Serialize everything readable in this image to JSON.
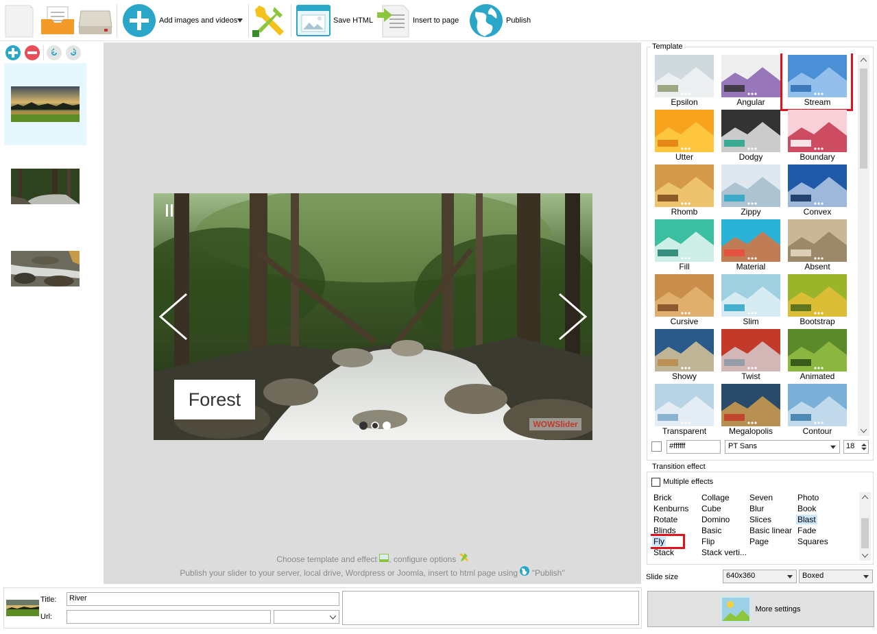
{
  "toolbar": {
    "add_images_label": "Add images and videos",
    "save_html_label": "Save HTML",
    "insert_label": "Insert to page",
    "publish_label": "Publish"
  },
  "slides": [
    {
      "name": "slide-sunset"
    },
    {
      "name": "slide-forest"
    },
    {
      "name": "slide-river"
    }
  ],
  "preview": {
    "caption": "Forest",
    "watermark": "WOWSlider",
    "hint_line1": "Choose template and effect",
    "hint_line1b": ", configure options",
    "hint_line2": "Publish your slider to your server, local drive, Wordpress or Joomla, insert to html page using",
    "hint_line2b": "\"Publish\""
  },
  "template": {
    "legend": "Template",
    "items": [
      "Epsilon",
      "Angular",
      "Stream",
      "Utter",
      "Dodgy",
      "Boundary",
      "Rhomb",
      "Zippy",
      "Convex",
      "Fill",
      "Material",
      "Absent",
      "Cursive",
      "Slim",
      "Bootstrap",
      "Showy",
      "Twist",
      "Animated",
      "Transparent",
      "Megalopolis",
      "Contour"
    ],
    "selected": "Stream",
    "color_value": "#ffffff",
    "font_value": "PT Sans",
    "font_size": "18"
  },
  "transition": {
    "legend": "Transition effect",
    "multiple_label": "Multiple effects",
    "columns": [
      [
        "Brick",
        "Kenburns",
        "Rotate",
        "Blinds",
        "Fly",
        "Stack"
      ],
      [
        "Collage",
        "Cube",
        "Domino",
        "Basic",
        "Flip",
        "Stack verti..."
      ],
      [
        "Seven",
        "Blur",
        "Slices",
        "Basic linear",
        "Page"
      ],
      [
        "Photo",
        "Book",
        "Blast",
        "Fade",
        "Squares"
      ]
    ],
    "selected": "Fly",
    "highlighted": "Blast"
  },
  "slide_size": {
    "label": "Slide size",
    "size_value": "640x360",
    "mode_value": "Boxed"
  },
  "more_settings_label": "More settings",
  "bottom": {
    "title_label": "Title:",
    "title_value": "River",
    "url_label": "Url:",
    "url_value": ""
  },
  "colors": {
    "accent_teal": "#2aa6c8",
    "selection_red": "#e0101c",
    "selected_slide_bg": "#e6f7fd",
    "preview_bg": "#dcdcdc"
  }
}
